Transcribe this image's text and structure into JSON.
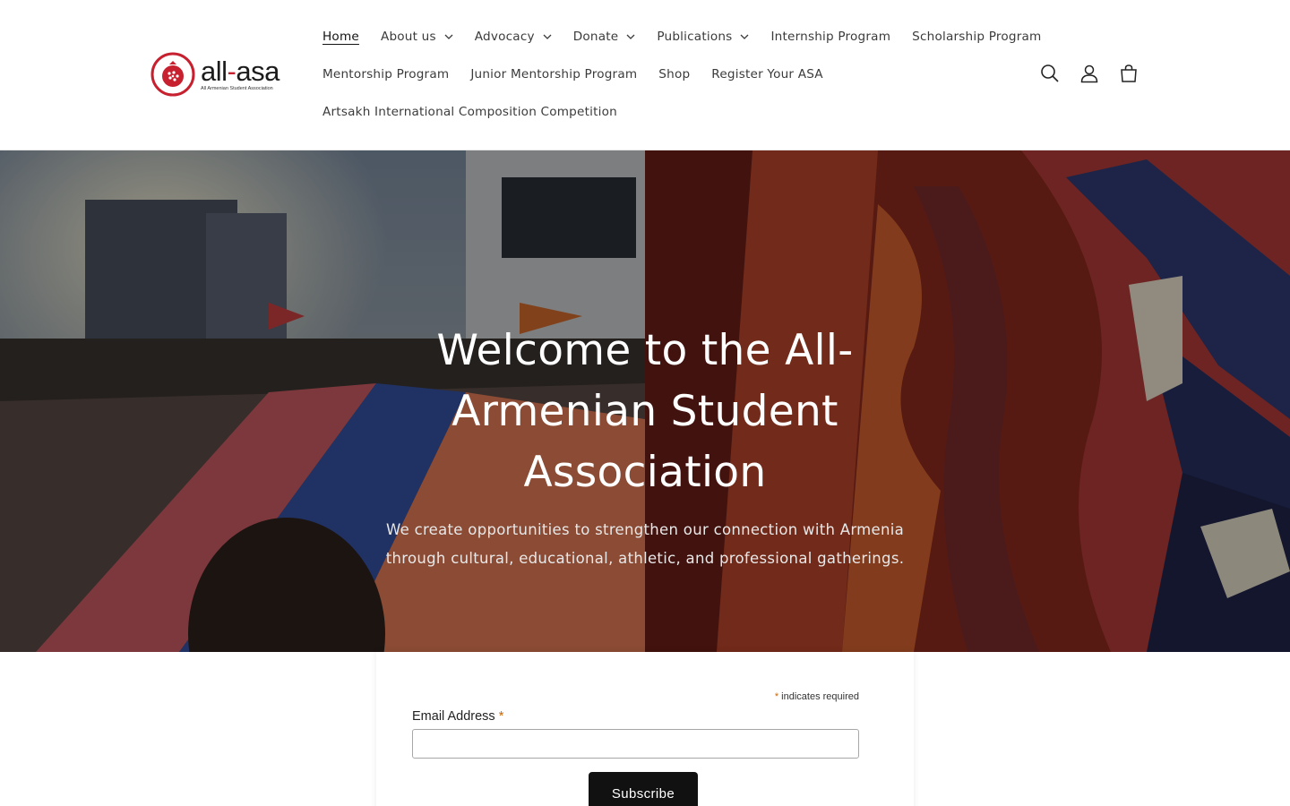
{
  "header": {
    "logo": {
      "wordmark_left": "all",
      "wordmark_dash": "-",
      "wordmark_right": "asa",
      "tagline": "All Armenian Student Association"
    },
    "nav_rows": [
      [
        {
          "label": "Home",
          "active": true,
          "dropdown": false
        },
        {
          "label": "About us",
          "active": false,
          "dropdown": true
        },
        {
          "label": "Advocacy",
          "active": false,
          "dropdown": true
        },
        {
          "label": "Donate",
          "active": false,
          "dropdown": true
        },
        {
          "label": "Publications",
          "active": false,
          "dropdown": true
        },
        {
          "label": "Internship Program",
          "active": false,
          "dropdown": false
        },
        {
          "label": "Scholarship Program",
          "active": false,
          "dropdown": false
        }
      ],
      [
        {
          "label": "Mentorship Program",
          "active": false,
          "dropdown": false
        },
        {
          "label": "Junior Mentorship Program",
          "active": false,
          "dropdown": false
        },
        {
          "label": "Shop",
          "active": false,
          "dropdown": false
        },
        {
          "label": "Register Your ASA",
          "active": false,
          "dropdown": false
        }
      ],
      [
        {
          "label": "Artsakh International Composition Competition",
          "active": false,
          "dropdown": false
        }
      ]
    ],
    "icons": [
      "search-icon",
      "account-icon",
      "cart-icon"
    ]
  },
  "hero": {
    "title": "Welcome to the All-Armenian Student Association",
    "subtitle": "We create opportunities to strengthen our connection with Armenia through cultural, educational, athletic, and professional gatherings."
  },
  "signup": {
    "required_note": "indicates required",
    "required_marker": "*",
    "email_label": "Email Address",
    "email_value": "",
    "button_label": "Subscribe"
  },
  "colors": {
    "brand_red": "#c7202f",
    "button_black": "#111111",
    "required_orange": "#cc6600"
  }
}
